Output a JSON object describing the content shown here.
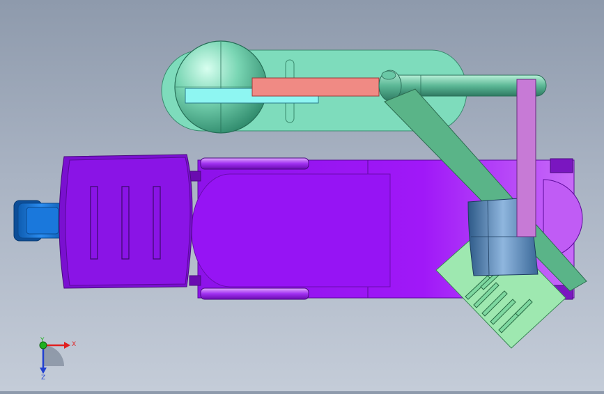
{
  "viewport": {
    "background_top": "#8e9aac",
    "background_bottom": "#c4ccd8"
  },
  "colors": {
    "purple_main": "#9a12f2",
    "purple_dark": "#7a10c8",
    "purple_light": "#c04cf5",
    "blue_knob": "#1e7ee0",
    "slot_green": "#7edcbc",
    "sphere_green": "#5fc3a0",
    "rod_cyan": "#8ef6f2",
    "rod_salmon": "#f08a84",
    "link_green": "#5ab488",
    "plate_green": "#9ee8b0",
    "column_violet": "#c77ad6",
    "cylinder_blue": "#5a88b8",
    "axis_x": "#e02020",
    "axis_y": "#20b020",
    "axis_z": "#2040d0"
  },
  "triad": {
    "x_label": "X",
    "y_label": "Y",
    "z_label": "Z"
  }
}
